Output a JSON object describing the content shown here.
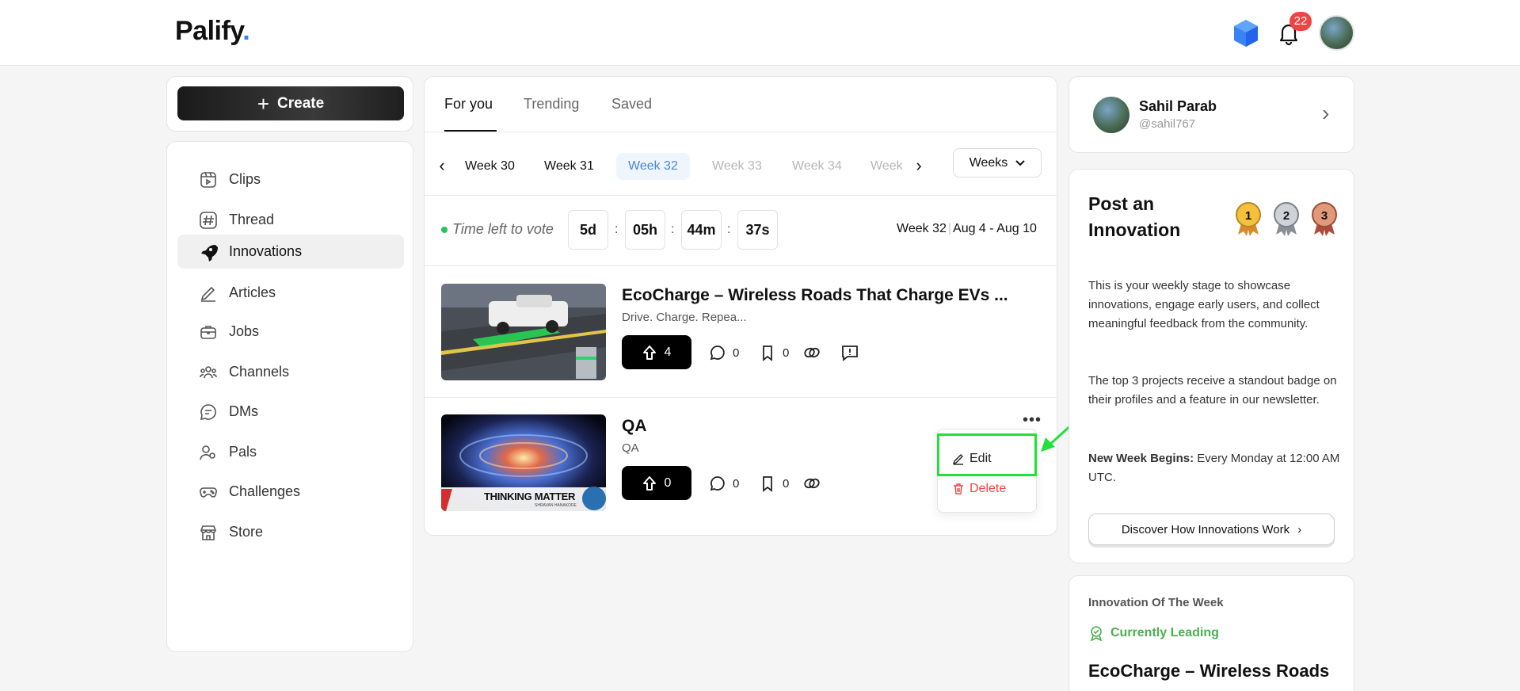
{
  "header": {
    "logo": "Palify",
    "logo_dot": ".",
    "notification_count": "22"
  },
  "sidebar": {
    "create_label": "Create",
    "items": [
      {
        "label": "Clips",
        "icon": "clips-icon"
      },
      {
        "label": "Thread",
        "icon": "hash-icon"
      },
      {
        "label": "Innovations",
        "icon": "rocket-icon",
        "active": true
      },
      {
        "label": "Articles",
        "icon": "pen-icon"
      },
      {
        "label": "Jobs",
        "icon": "briefcase-icon"
      },
      {
        "label": "Channels",
        "icon": "users-icon"
      },
      {
        "label": "DMs",
        "icon": "chat-icon"
      },
      {
        "label": "Pals",
        "icon": "pals-icon"
      },
      {
        "label": "Challenges",
        "icon": "gamepad-icon"
      },
      {
        "label": "Store",
        "icon": "store-icon"
      }
    ]
  },
  "feed": {
    "tabs": [
      "For you",
      "Trending",
      "Saved"
    ],
    "active_tab": "For you",
    "weeks": [
      "Week 30",
      "Week 31",
      "Week 32",
      "Week 33",
      "Week 34",
      "Week"
    ],
    "selected_week": "Week 32",
    "weeks_dropdown": "Weeks",
    "vote_label": "Time left to vote",
    "timer": {
      "days": "5d",
      "hours": "05h",
      "minutes": "44m",
      "seconds": "37s"
    },
    "current_week": "Week 32",
    "week_dates": "Aug 4 - Aug 10",
    "posts": [
      {
        "title": "EcoCharge – Wireless Roads That Charge EVs ...",
        "subtitle": "Drive. Charge. Repea...",
        "upvotes": "4",
        "comments": "0",
        "saves": "0"
      },
      {
        "title": "QA",
        "subtitle": "QA",
        "thumb_caption": "THINKING MATTER",
        "thumb_subcaption": "SHRAVAN HANAKODE",
        "upvotes": "0",
        "comments": "0",
        "saves": "0"
      }
    ],
    "menu": {
      "edit": "Edit",
      "delete": "Delete"
    }
  },
  "profile": {
    "name": "Sahil Parab",
    "handle": "@sahil767"
  },
  "innovation_panel": {
    "title": "Post an Innovation",
    "p1": "This is your weekly stage to showcase innovations, engage early users, and collect meaningful feedback from the community.",
    "p2": "The top 3 projects receive a standout badge on their profiles and a feature in our newsletter.",
    "p3_bold": "New Week Begins:",
    "p3_rest": " Every Monday at 12:00 AM UTC.",
    "discover": "Discover How Innovations Work",
    "medals": [
      "1",
      "2",
      "3"
    ]
  },
  "otw": {
    "label": "Innovation Of The Week",
    "leading": "Currently Leading",
    "title": "EcoCharge – Wireless Roads"
  },
  "colors": {
    "accent": "#3b82f6",
    "badge": "#ef4444",
    "success": "#22c55e",
    "highlight": "#22e03a"
  }
}
